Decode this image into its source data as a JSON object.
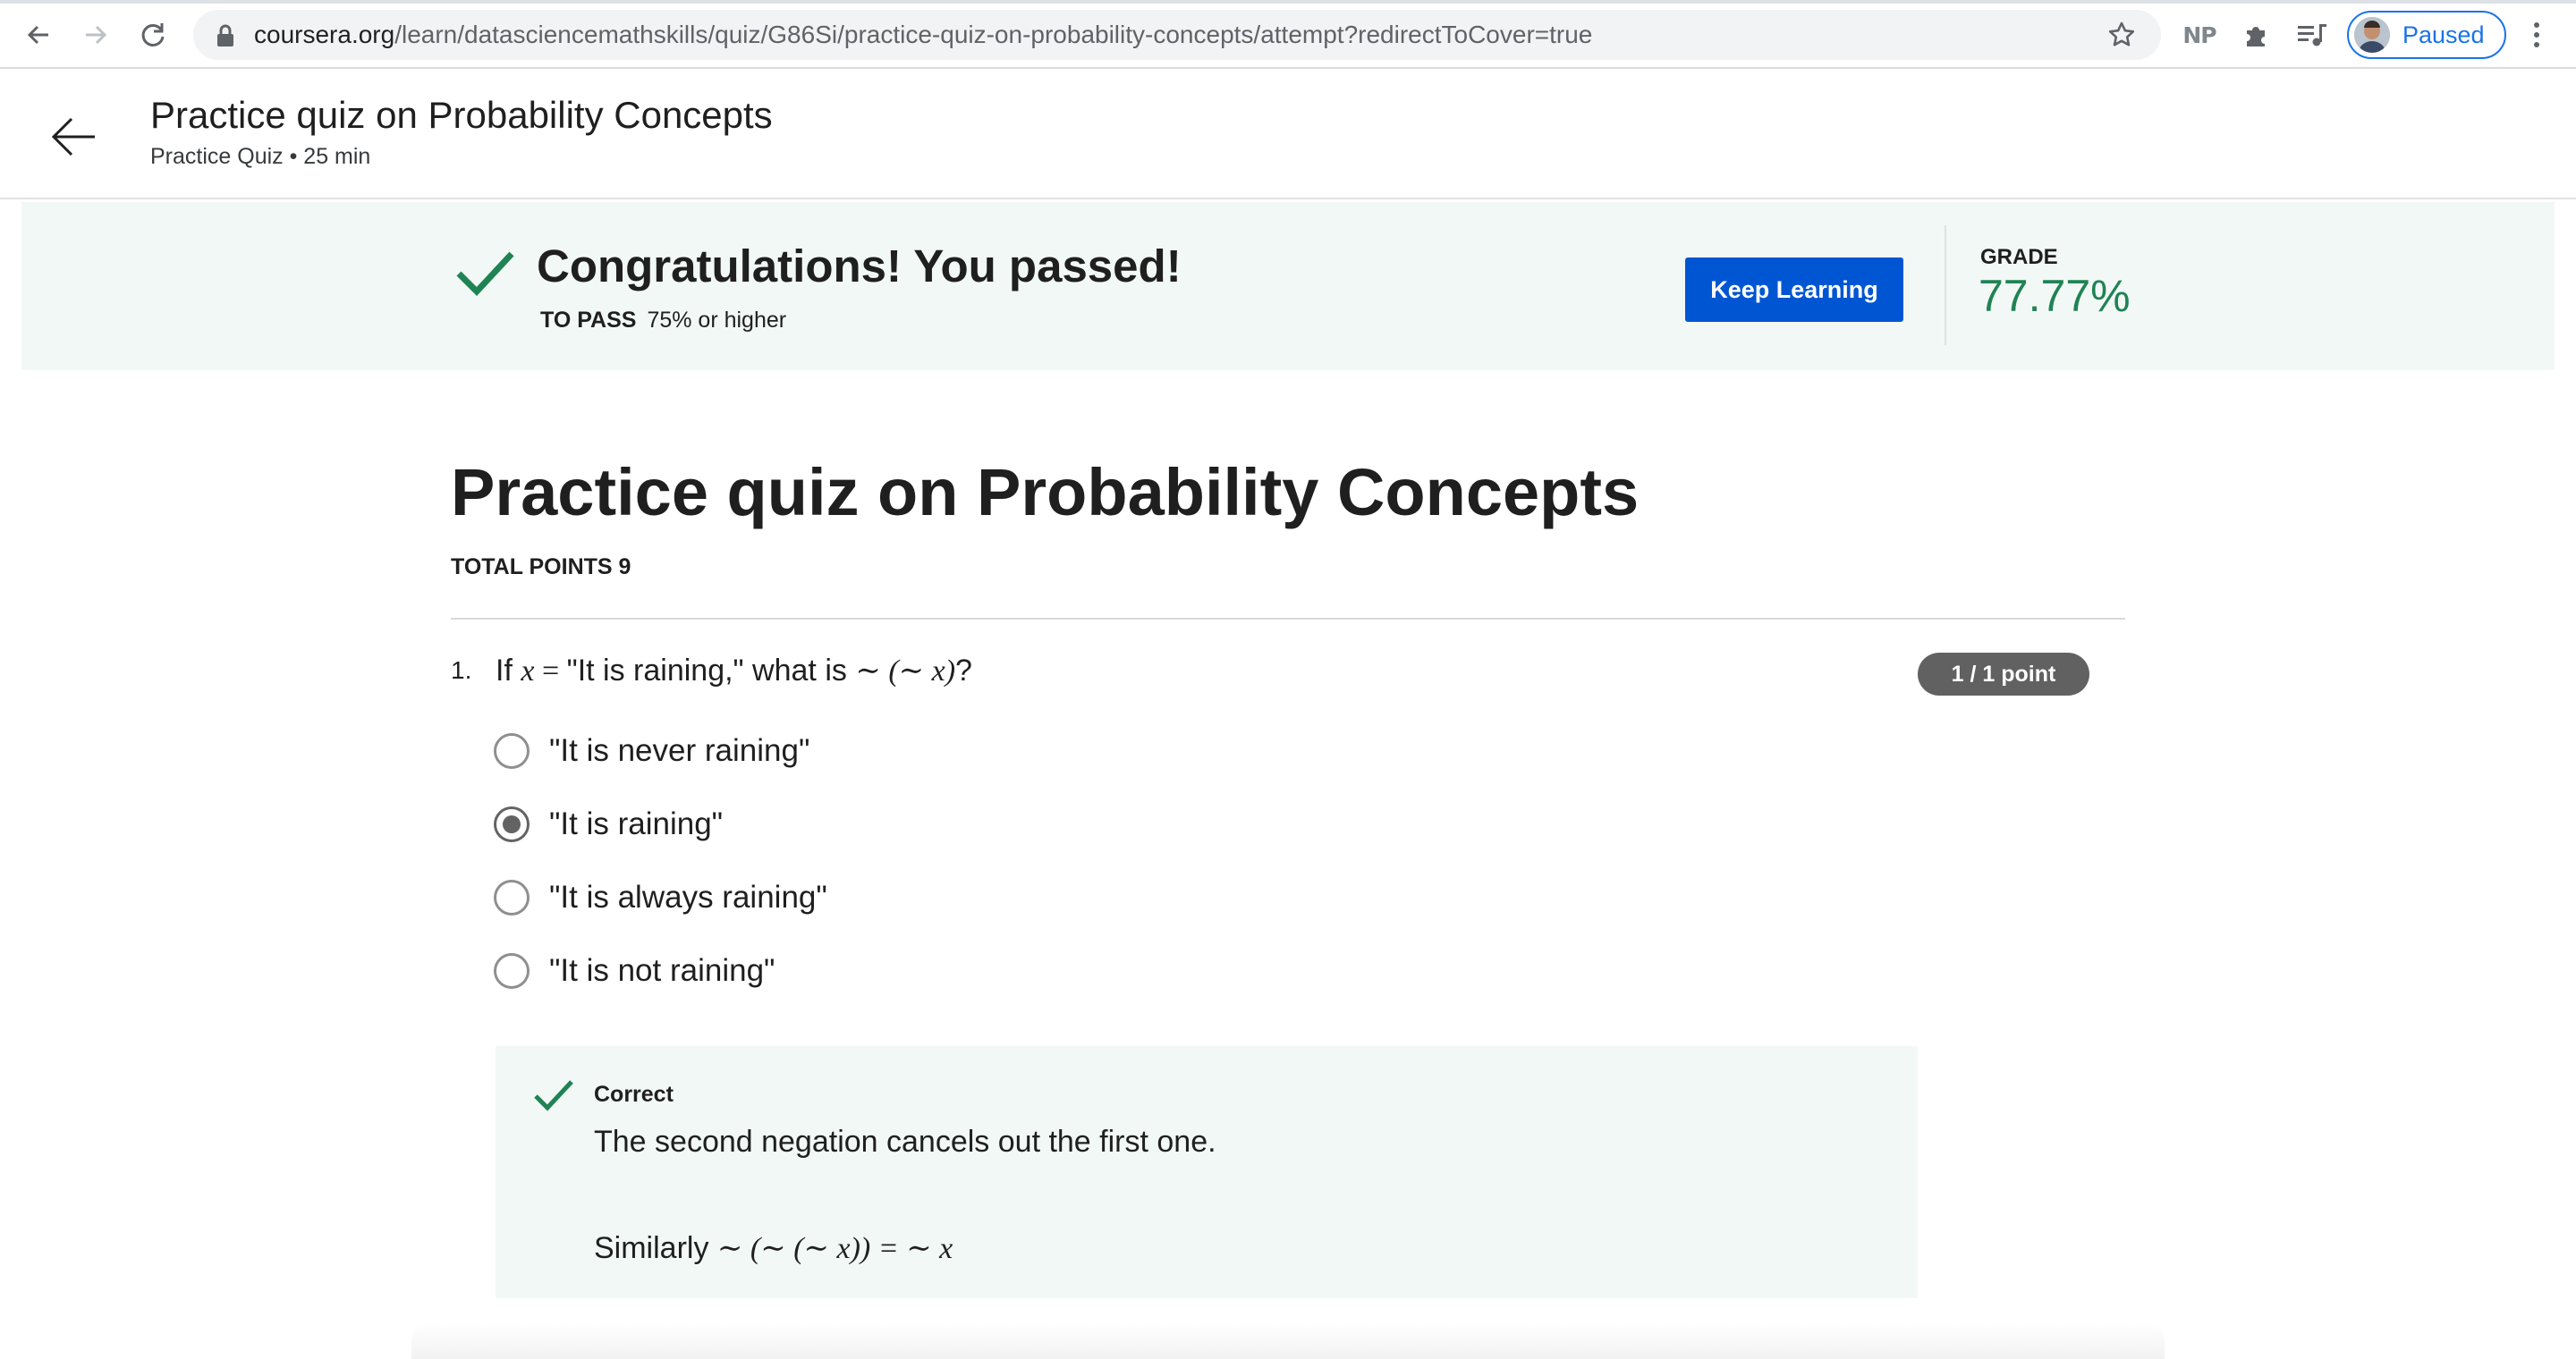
{
  "browser": {
    "url_host": "coursera.org",
    "url_path": "/learn/datasciencemathskills/quiz/G86Si/practice-quiz-on-probability-concepts/attempt?redirectToCover=true",
    "extension_np_label": "NP",
    "profile_status": "Paused"
  },
  "header": {
    "title": "Practice quiz on Probability Concepts",
    "subtitle": "Practice Quiz • 25 min"
  },
  "banner": {
    "title": "Congratulations! You passed!",
    "to_pass_label": "TO PASS",
    "to_pass_value": "75% or higher",
    "button_label": "Keep Learning",
    "grade_label": "GRADE",
    "grade_value": "77.77%",
    "accent_color": "#1f8354"
  },
  "quiz": {
    "title": "Practice quiz on Probability Concepts",
    "total_points": "TOTAL POINTS 9"
  },
  "question": {
    "number": "1.",
    "text_prefix": "If ",
    "text_var": "x",
    "text_eq": " = ",
    "text_quote": "\"It is raining,\" what is ",
    "text_expr": "∼ (∼ x)",
    "text_suffix": "?",
    "points": "1 / 1 point",
    "options": [
      {
        "label": "\"It is never raining\"",
        "selected": false
      },
      {
        "label": "\"It is raining\"",
        "selected": true
      },
      {
        "label": "\"It is always raining\"",
        "selected": false
      },
      {
        "label": "\"It is not raining\"",
        "selected": false
      }
    ],
    "feedback": {
      "status": "Correct",
      "text": "The second negation cancels out the first one.",
      "similarly_prefix": "Similarly ",
      "similarly_expr": "∼ (∼ (∼ x)) = ∼ x"
    }
  }
}
